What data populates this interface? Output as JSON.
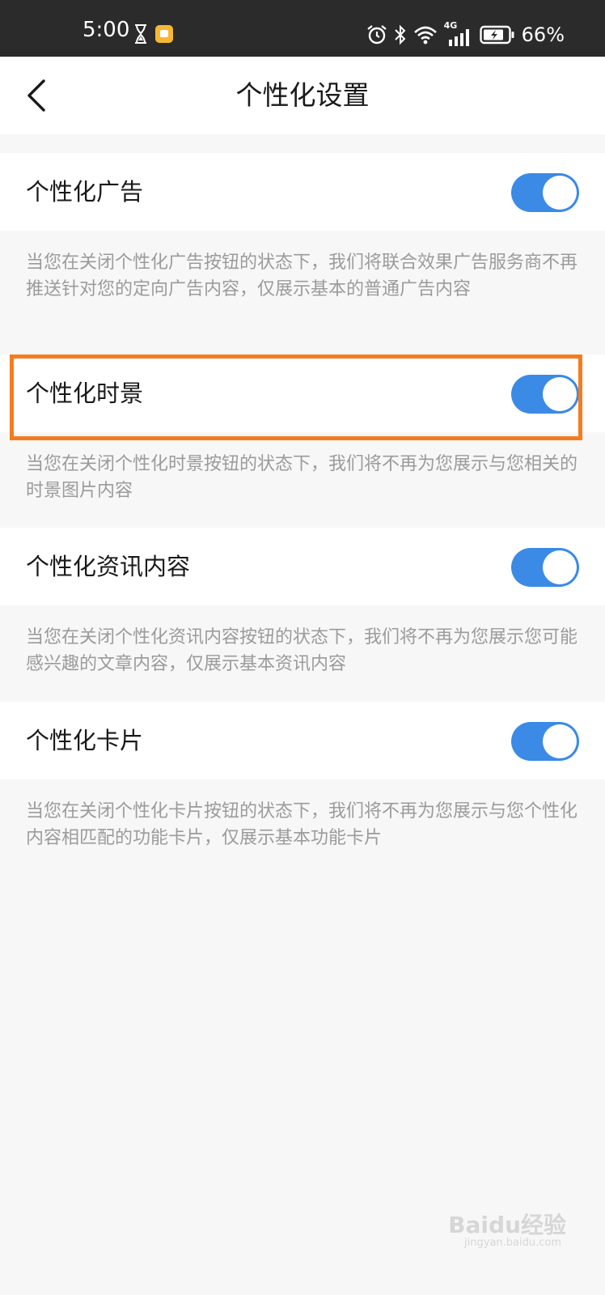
{
  "status_bar": {
    "time": "5:00",
    "battery_percent": "66%",
    "icons": [
      "hourglass-icon",
      "app-notification-icon",
      "alarm-icon",
      "bluetooth-icon",
      "wifi-icon",
      "cellular-4g-icon",
      "battery-icon"
    ],
    "network_label": "4G"
  },
  "header": {
    "title": "个性化设置",
    "back_icon": "chevron-left-icon"
  },
  "settings": [
    {
      "label": "个性化广告",
      "enabled": true,
      "description": "当您在关闭个性化广告按钮的状态下，我们将联合效果广告服务商不再推送针对您的定向广告内容，仅展示基本的普通广告内容"
    },
    {
      "label": "个性化时景",
      "enabled": true,
      "description": "当您在关闭个性化时景按钮的状态下，我们将不再为您展示与您相关的时景图片内容"
    },
    {
      "label": "个性化资讯内容",
      "enabled": true,
      "description": "当您在关闭个性化资讯内容按钮的状态下，我们将不再为您展示您可能感兴趣的文章内容，仅展示基本资讯内容"
    },
    {
      "label": "个性化卡片",
      "enabled": true,
      "description": "当您在关闭个性化卡片按钮的状态下，我们将不再为您展示与您个性化内容相匹配的功能卡片，仅展示基本功能卡片"
    }
  ],
  "colors": {
    "toggle_on": "#3b8ae6",
    "highlight": "#f47c20",
    "status_bar_bg": "#2b2b2b"
  },
  "watermark": {
    "text": "Baidu经验",
    "sub": "jingyan.baidu.com"
  }
}
